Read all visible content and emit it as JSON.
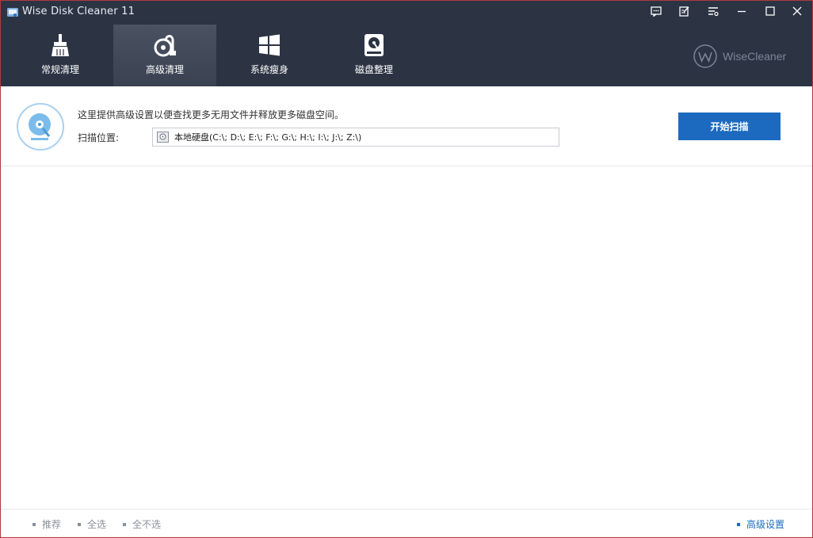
{
  "window": {
    "title": "Wise Disk Cleaner 11"
  },
  "toolbar": {
    "tabs": [
      {
        "label": "常规清理",
        "icon": "broom-icon"
      },
      {
        "label": "高级清理",
        "icon": "vacuum-icon",
        "active": true
      },
      {
        "label": "系统瘦身",
        "icon": "windows-icon"
      },
      {
        "label": "磁盘整理",
        "icon": "defrag-disk-icon"
      }
    ],
    "brand": "WiseCleaner"
  },
  "panel": {
    "description": "这里提供高级设置以便查找更多无用文件并释放更多磁盘空间。",
    "location_label": "扫描位置:",
    "location_value": "本地硬盘(C:\\; D:\\; E:\\; F:\\; G:\\; H:\\; I:\\; J:\\; Z:\\)",
    "scan_button": "开始扫描"
  },
  "footer": {
    "recommended": "推荐",
    "select_all": "全选",
    "select_none": "全不选",
    "advanced_settings": "高级设置"
  },
  "colors": {
    "titlebar_bg": "#2c3444",
    "accent": "#1c6ac0",
    "footer_text": "#8a8f98"
  }
}
